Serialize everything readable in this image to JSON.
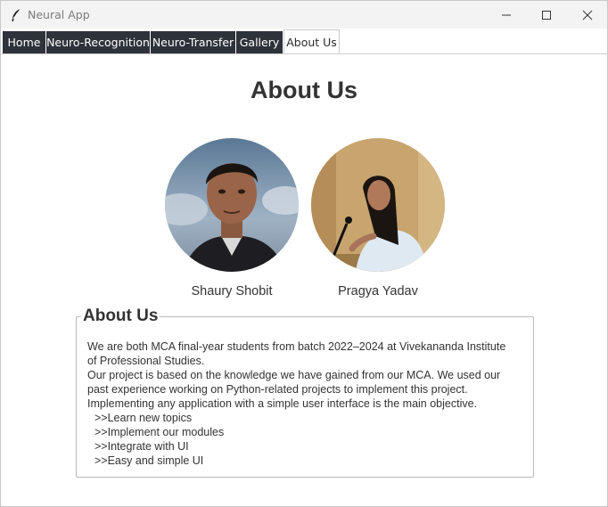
{
  "window": {
    "title": "Neural App",
    "app_icon": "feather-icon"
  },
  "tabs": [
    {
      "label": "Home",
      "active": false
    },
    {
      "label": "Neuro-Recognition",
      "active": false
    },
    {
      "label": "Neuro-Transfer",
      "active": false
    },
    {
      "label": "Gallery",
      "active": false
    },
    {
      "label": "About Us",
      "active": true
    }
  ],
  "page": {
    "title": "About Us"
  },
  "team": [
    {
      "name": "Shaury Shobit"
    },
    {
      "name": "Pragya Yadav"
    }
  ],
  "about": {
    "heading": "About Us",
    "lines": [
      "We are both MCA final-year students from batch 2022–2024 at Vivekananda Institute",
      "of Professional Studies.",
      "Our project is based on the knowledge we have gained from our MCA. We used our",
      "past experience working on Python-related projects to implement this project.",
      "Implementing any application with a simple user interface is the main objective."
    ],
    "points": [
      ">>Learn new topics",
      ">>Implement our modules",
      ">>Integrate with UI",
      ">>Easy and simple UI"
    ]
  },
  "colors": {
    "tab_dark": "#2e323a",
    "text": "#333333",
    "titlebar": "#f3f3f3"
  }
}
